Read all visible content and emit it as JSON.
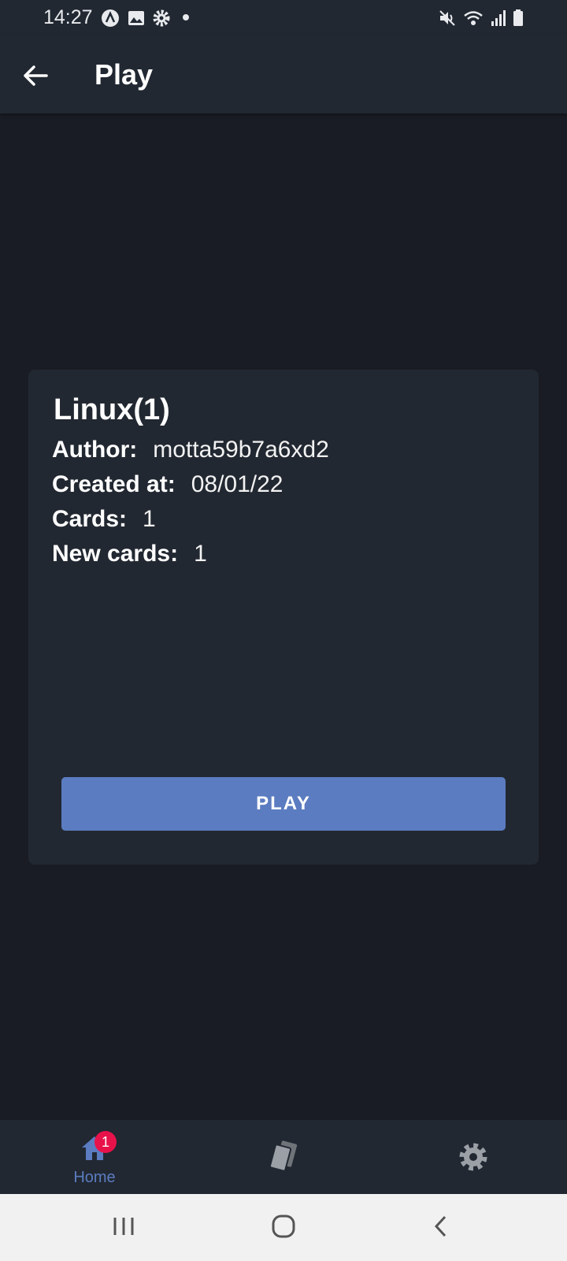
{
  "status_bar": {
    "time": "14:27",
    "icons": [
      "app-a-icon",
      "gallery-icon",
      "settings-gear-icon",
      "notification-dot-icon",
      "mute-icon",
      "wifi-icon",
      "signal-icon",
      "battery-icon"
    ]
  },
  "app_bar": {
    "back_icon": "arrow-left-icon",
    "title": "Play"
  },
  "deck": {
    "title": "Linux(1)",
    "author_label": "Author:",
    "author": "motta59b7a6xd2",
    "created_label": "Created at:",
    "created": "08/01/22",
    "cards_label": "Cards:",
    "cards": "1",
    "new_cards_label": "New cards:",
    "new_cards": "1",
    "play_label": "PLAY"
  },
  "bottom_nav": {
    "home_label": "Home",
    "home_badge": "1",
    "items": [
      "home-icon",
      "cards-icon",
      "settings-icon"
    ]
  },
  "colors": {
    "background": "#191c24",
    "surface": "#222831",
    "accent": "#5b7cc0",
    "badge": "#e8124a"
  }
}
